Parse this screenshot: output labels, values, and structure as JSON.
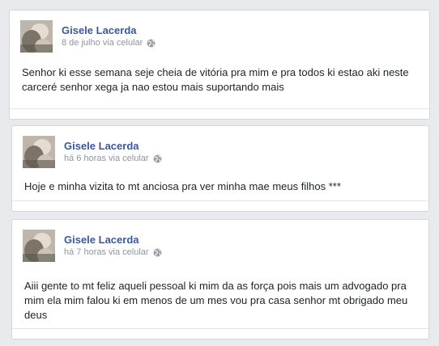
{
  "posts": [
    {
      "author": "Gisele Lacerda",
      "time": "8 de julho via celular",
      "audience_icon": "globe-icon",
      "text": "Senhor ki esse semana seje cheia de vitória pra mim e pra todos ki estao aki neste carceré senhor xega ja nao estou mais suportando mais"
    },
    {
      "author": "Gisele Lacerda",
      "time": "há 6 horas via celular",
      "audience_icon": "globe-icon",
      "text": "Hoje e minha vizita to mt anciosa pra ver minha mae meus filhos ***"
    },
    {
      "author": "Gisele Lacerda",
      "time": "há 7 horas via celular",
      "audience_icon": "globe-icon",
      "text": "Aiii gente to mt feliz aqueli pessoal ki mim da as força pois mais um advogado pra mim ela mim falou ki em menos de um mes vou pra casa senhor mt obrigado meu deus"
    }
  ],
  "colors": {
    "page_bg": "#e9eaed",
    "author_link": "#3b5998",
    "meta_text": "#90949c",
    "body_text": "#1d2129"
  }
}
